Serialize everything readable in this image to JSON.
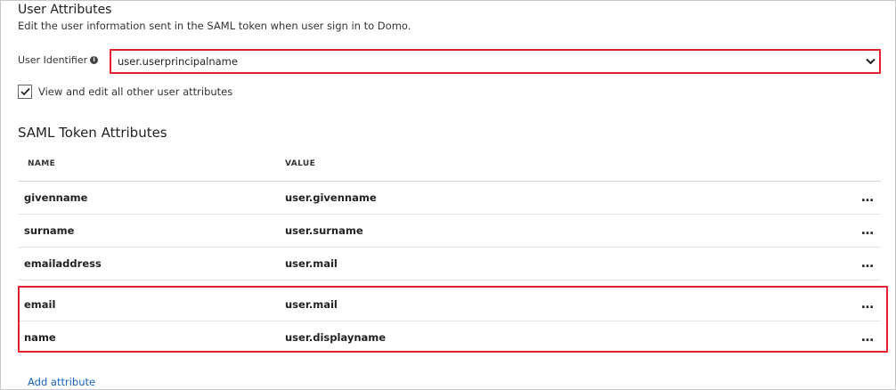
{
  "user_attributes": {
    "title": "User Attributes",
    "description": "Edit the user information sent in the SAML token when user sign in to Domo.",
    "identifier_label": "User Identifier",
    "identifier_value": "user.userprincipalname",
    "checkbox_label": "View and edit all other user attributes",
    "checkbox_checked": true
  },
  "saml": {
    "title": "SAML Token Attributes",
    "columns": {
      "name": "NAME",
      "value": "VALUE"
    },
    "rows": [
      {
        "name": "givenname",
        "value": "user.givenname"
      },
      {
        "name": "surname",
        "value": "user.surname"
      },
      {
        "name": "emailaddress",
        "value": "user.mail"
      },
      {
        "name": "email",
        "value": "user.mail"
      },
      {
        "name": "name",
        "value": "user.displayname"
      }
    ],
    "more_label": "…",
    "add_attribute_label": "Add attribute"
  },
  "colors": {
    "highlight": "#e0202f",
    "link": "#1a63b8"
  }
}
